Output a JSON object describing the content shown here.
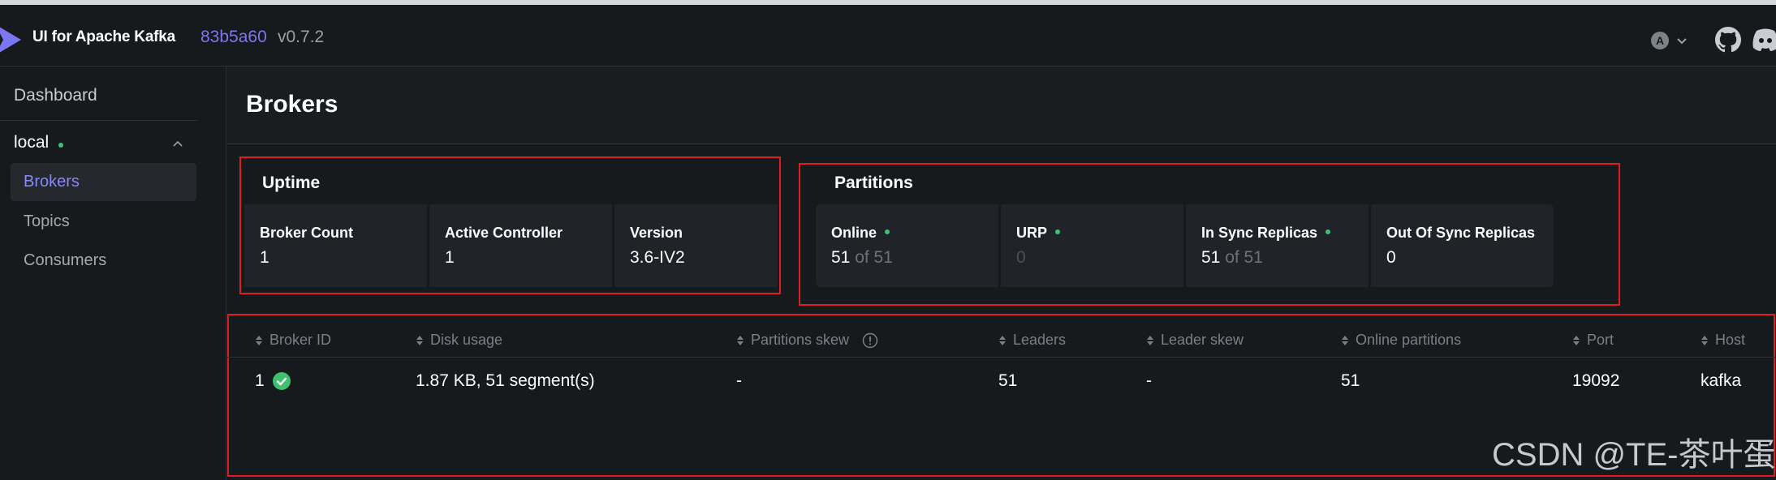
{
  "app": {
    "title": "UI for Apache Kafka",
    "commit": "83b5a60",
    "version": "v0.7.2",
    "lang_badge": "A",
    "accent_color": "#7b76f2",
    "status_color": "#3ec26f",
    "highlight_color": "#e01b24"
  },
  "sidebar": {
    "dashboard": "Dashboard",
    "cluster": "local",
    "items": [
      {
        "label": "Brokers",
        "active": true
      },
      {
        "label": "Topics",
        "active": false
      },
      {
        "label": "Consumers",
        "active": false
      }
    ]
  },
  "page": {
    "title": "Brokers"
  },
  "uptime": {
    "title": "Uptime",
    "cards": [
      {
        "label": "Broker Count",
        "value": "1"
      },
      {
        "label": "Active Controller",
        "value": "1"
      },
      {
        "label": "Version",
        "value": "3.6-IV2"
      }
    ]
  },
  "partitions": {
    "title": "Partitions",
    "online": {
      "label": "Online",
      "value": "51",
      "of": "of 51"
    },
    "urp": {
      "label": "URP",
      "value": "0"
    },
    "in_sync": {
      "label": "In Sync Replicas",
      "value": "51",
      "of": "of 51"
    },
    "out_of_sync": {
      "label": "Out Of Sync Replicas",
      "value": "0"
    }
  },
  "table": {
    "columns": [
      "Broker ID",
      "Disk usage",
      "Partitions skew",
      "Leaders",
      "Leader skew",
      "Online partitions",
      "Port",
      "Host"
    ],
    "rows": [
      {
        "broker_id": "1",
        "disk_usage": "1.87 KB, 51 segment(s)",
        "partitions_skew": "-",
        "leaders": "51",
        "leader_skew": "-",
        "online_partitions": "51",
        "port": "19092",
        "host": "kafka"
      }
    ]
  },
  "watermark": "CSDN @TE-茶叶蛋"
}
